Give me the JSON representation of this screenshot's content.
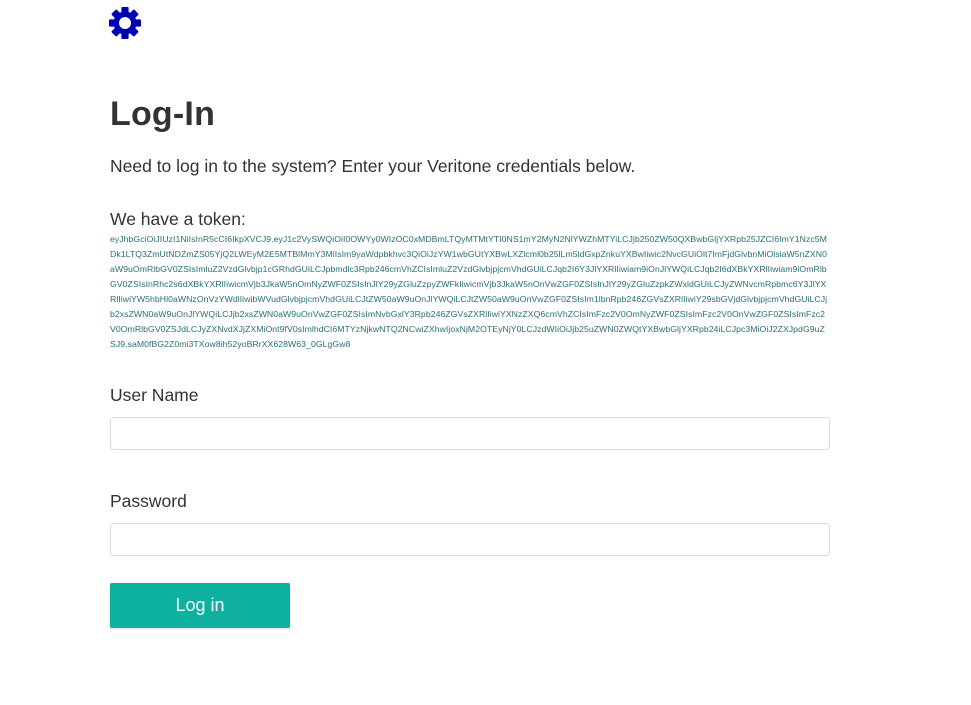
{
  "logo": {
    "icon": "gear-icon",
    "color": "#0000b3"
  },
  "page": {
    "title": "Log-In",
    "intro": "Need to log in to the system? Enter your Veritone credentials below."
  },
  "token": {
    "heading": "We have a token:",
    "value": "eyJhbGciOiJIUzI1NiIsInR5cCI6IkpXVCJ9.eyJ1c2VySWQiOiI0OWYy0WIzOC0xMDBmLTQyMTMtYTI0NS1mY2MyN2NlYWZhMTYiLCJjb250ZW50QXBwbGljYXRpb25JZCI6ImY1Nzc5MDk1LTQ3ZmUtNDZmZS05YjQ2LWEyM2E5MTBlMmY3MiIsIm9yaWdpbkhvc3QiOiJzYW1wbGUtYXBwLXZlcml0b25lLm5ldGxpZnkuYXBwIiwic2NvcGUiOlt7ImFjdGlvbnMiOlsiaW5nZXN0aW9uOmRlbGV0ZSIsImluZ2VzdGlvbjp1cGRhdGUiLCJpbmdlc3Rpb246cmVhZCIsImluZ2VzdGlvbjpjcmVhdGUiLCJqb2I6Y3JlYXRlIiwiam9iOnJlYWQiLCJqb2I6dXBkYXRlIiwiam9iOmRlbGV0ZSIsInRhc2s6dXBkYXRlIiwicmVjb3JkaW5nOmNyZWF0ZSIsInJlY29yZGluZzpyZWFkIiwicmVjb3JkaW5nOnVwZGF0ZSIsInJlY29yZGluZzpkZWxldGUiLCJyZWNvcmRpbmc6Y3JlYXRlIiwiYW5hbHl0aWNzOnVzYWdlIiwibWVudGlvbjpjcmVhdGUiLCJtZW50aW9uOnJlYWQiLCJtZW50aW9uOnVwZGF0ZSIsIm1lbnRpb246ZGVsZXRlIiwiY29sbGVjdGlvbjpjcmVhdGUiLCJjb2xsZWN0aW9uOnJlYWQiLCJjb2xsZWN0aW9uOnVwZGF0ZSIsImNvbGxlY3Rpb246ZGVsZXRlIiwiYXNzZXQ6cmVhZCIsImFzc2V0OmNyZWF0ZSIsImFzc2V0OnVwZGF0ZSIsImFzc2V0OmRlbGV0ZSJdLCJyZXNvdXJjZXMiOnt9fV0sImlhdCI6MTYzNjkwNTQ2NCwiZXhwIjoxNjM2OTEyNjY0LCJzdWIiOiJjb25uZWN0ZWQtYXBwbGljYXRpb24iLCJpc3MiOiJ2ZXJpdG9uZSJ9.saM0fBG2Z0mi3TXow8ih52yoBRrXX628W63_0GLgGw8"
  },
  "form": {
    "username_label": "User Name",
    "username_value": "",
    "password_label": "Password",
    "password_value": "",
    "submit_label": "Log in",
    "accent_color": "#0eb19f"
  }
}
